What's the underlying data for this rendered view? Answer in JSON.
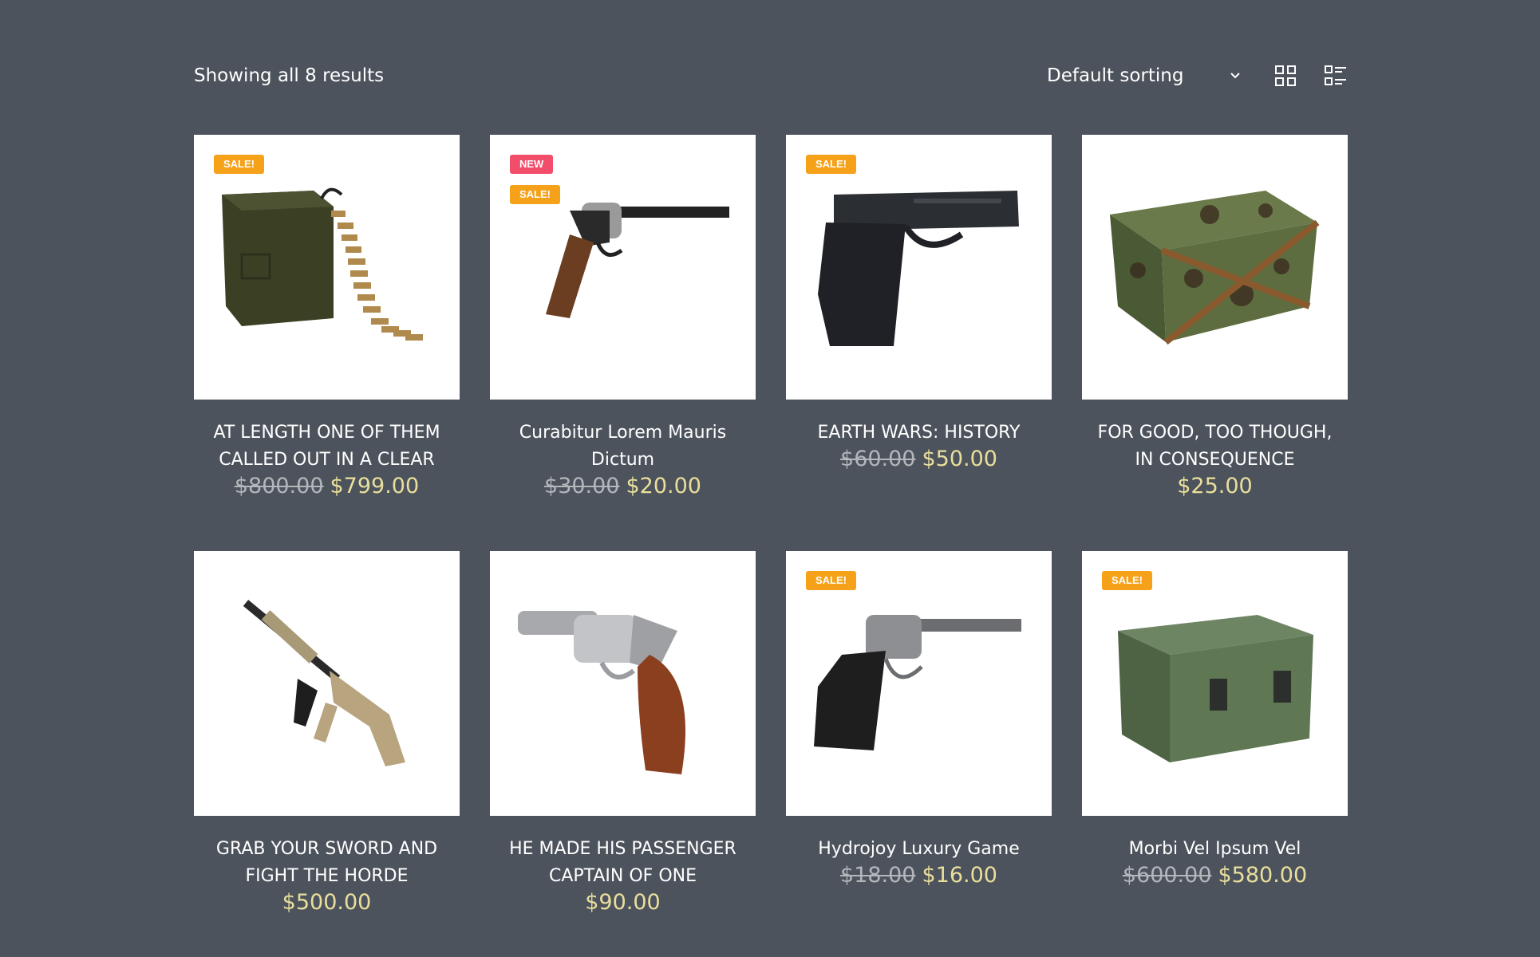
{
  "toolbar": {
    "result_count": "Showing all 8 results",
    "sort_label": "Default sorting",
    "sort_icon": "chevron-down-icon",
    "grid_view_icon": "grid-view-icon",
    "list_view_icon": "list-view-icon"
  },
  "colors": {
    "background": "#4d535c",
    "sale_badge": "#f5a11a",
    "new_badge": "#f24d6a",
    "price": "#e9df9c",
    "old_price": "#b3b6ba"
  },
  "products": [
    {
      "title": "AT LENGTH ONE OF THEM CALLED OUT IN A CLEAR",
      "badges": [
        "SALE!"
      ],
      "old_price": "$800.00",
      "price": "$799.00",
      "image": "ammo-can-image"
    },
    {
      "title": "Curabitur Lorem Mauris Dictum",
      "badges": [
        "NEW",
        "SALE!"
      ],
      "old_price": "$30.00",
      "price": "$20.00",
      "image": "revolver-image"
    },
    {
      "title": "EARTH WARS: HISTORY",
      "badges": [
        "SALE!"
      ],
      "old_price": "$60.00",
      "price": "$50.00",
      "image": "pistol-image"
    },
    {
      "title": "FOR GOOD, TOO THOUGH, IN CONSEQUENCE",
      "badges": [],
      "old_price": "",
      "price": "$25.00",
      "image": "camo-crate-image"
    },
    {
      "title": "GRAB YOUR SWORD AND FIGHT THE HORDE",
      "badges": [],
      "old_price": "",
      "price": "$500.00",
      "image": "rifle-image"
    },
    {
      "title": "HE MADE HIS PASSENGER CAPTAIN OF ONE",
      "badges": [],
      "old_price": "",
      "price": "$90.00",
      "image": "snub-revolver-image"
    },
    {
      "title": "Hydrojoy Luxury Game",
      "badges": [
        "SALE!"
      ],
      "old_price": "$18.00",
      "price": "$16.00",
      "image": "old-revolver-image"
    },
    {
      "title": "Morbi Vel Ipsum Vel",
      "badges": [
        "SALE!"
      ],
      "old_price": "$600.00",
      "price": "$580.00",
      "image": "green-case-image"
    }
  ]
}
